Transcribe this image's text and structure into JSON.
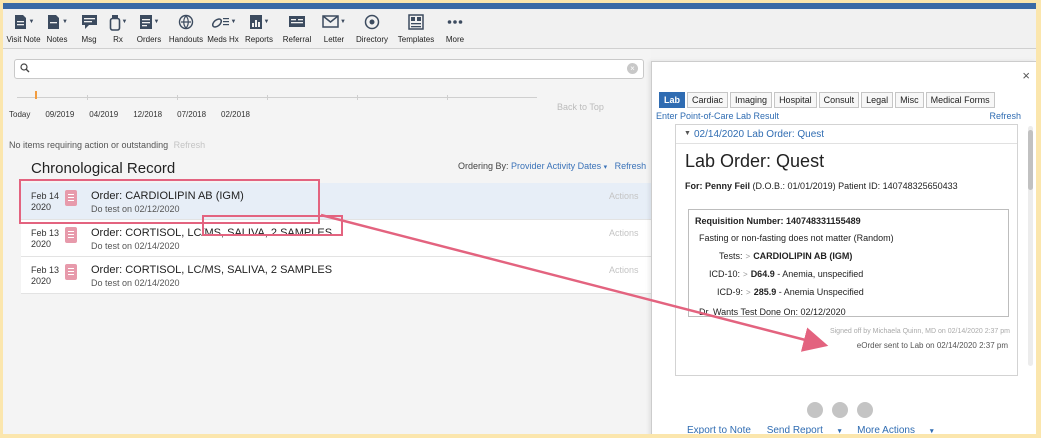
{
  "toolbar": {
    "items": [
      {
        "label": "Visit Note",
        "icon": "visit-note-icon"
      },
      {
        "label": "Notes",
        "icon": "notes-icon"
      },
      {
        "label": "Msg",
        "icon": "message-icon"
      },
      {
        "label": "Rx",
        "icon": "rx-bottle-icon"
      },
      {
        "label": "Orders",
        "icon": "orders-icon"
      },
      {
        "label": "Handouts",
        "icon": "handouts-icon"
      },
      {
        "label": "Meds Hx",
        "icon": "meds-history-icon"
      },
      {
        "label": "Reports",
        "icon": "reports-icon"
      },
      {
        "label": "Referral",
        "icon": "referral-icon"
      },
      {
        "label": "Letter",
        "icon": "letter-icon"
      },
      {
        "label": "Directory",
        "icon": "directory-icon"
      },
      {
        "label": "Templates",
        "icon": "templates-icon"
      },
      {
        "label": "More",
        "icon": "more-dots-icon"
      }
    ]
  },
  "search": {
    "placeholder": ""
  },
  "timeline": {
    "labels": [
      "Today",
      "09/2019",
      "04/2019",
      "12/2018",
      "07/2018",
      "02/2018"
    ],
    "back_to_top": "Back to Top"
  },
  "status": {
    "no_items": "No items requiring action or outstanding",
    "refresh": "Refresh"
  },
  "chronological": {
    "title": "Chronological Record",
    "ordering_prefix": "Ordering By:",
    "ordering_value": "Provider Activity Dates",
    "refresh": "Refresh"
  },
  "records": [
    {
      "month_day": "Feb 14",
      "year": "2020",
      "title": "Order: CARDIOLIPIN AB (IGM)",
      "subtitle": "Do test on 02/12/2020",
      "actions": "Actions"
    },
    {
      "month_day": "Feb 13",
      "year": "2020",
      "title": "Order: CORTISOL, LC/MS, SALIVA, 2 SAMPLES",
      "subtitle": "Do test on 02/14/2020",
      "actions": "Actions"
    },
    {
      "month_day": "Feb 13",
      "year": "2020",
      "title": "Order: CORTISOL, LC/MS, SALIVA, 2 SAMPLES",
      "subtitle": "Do test on 02/14/2020",
      "actions": "Actions"
    }
  ],
  "panel": {
    "close": "×",
    "tabs": [
      "Lab",
      "Cardiac",
      "Imaging",
      "Hospital",
      "Consult",
      "Legal",
      "Misc",
      "Medical Forms"
    ],
    "enter_poc": "Enter Point-of-Care Lab Result",
    "refresh": "Refresh",
    "header": "02/14/2020  Lab Order: Quest",
    "order_title": "Lab Order: Quest",
    "for_label": "For:",
    "patient_name": "Penny Feil",
    "patient_info": "(D.O.B.: 01/01/2019) Patient ID: 140748325650433",
    "requisition": "Requisition Number: 140748331155489",
    "fasting": "Fasting or non-fasting does not matter (Random)",
    "tests_label": "Tests:",
    "tests_value": "CARDIOLIPIN AB (IGM)",
    "icd10_label": "ICD-10:",
    "icd10_code": "D64.9",
    "icd10_desc": "- Anemia, unspecified",
    "icd9_label": "ICD-9:",
    "icd9_code": "285.9",
    "icd9_desc": "- Anemia Unspecified",
    "wants": "Dr. Wants Test Done On: 02/12/2020",
    "signed": "Signed off by Michaela Quinn, MD on 02/14/2020 2:37 pm",
    "eorder": "eOrder sent to Lab on 02/14/2020 2:37 pm",
    "export": "Export to Note",
    "send_report": "Send Report",
    "more_actions": "More Actions"
  },
  "colors": {
    "accent": "#2f6cb2",
    "highlight": "#e3637f",
    "doc_icon": "#e79aab",
    "background": "#fbe6ad"
  }
}
